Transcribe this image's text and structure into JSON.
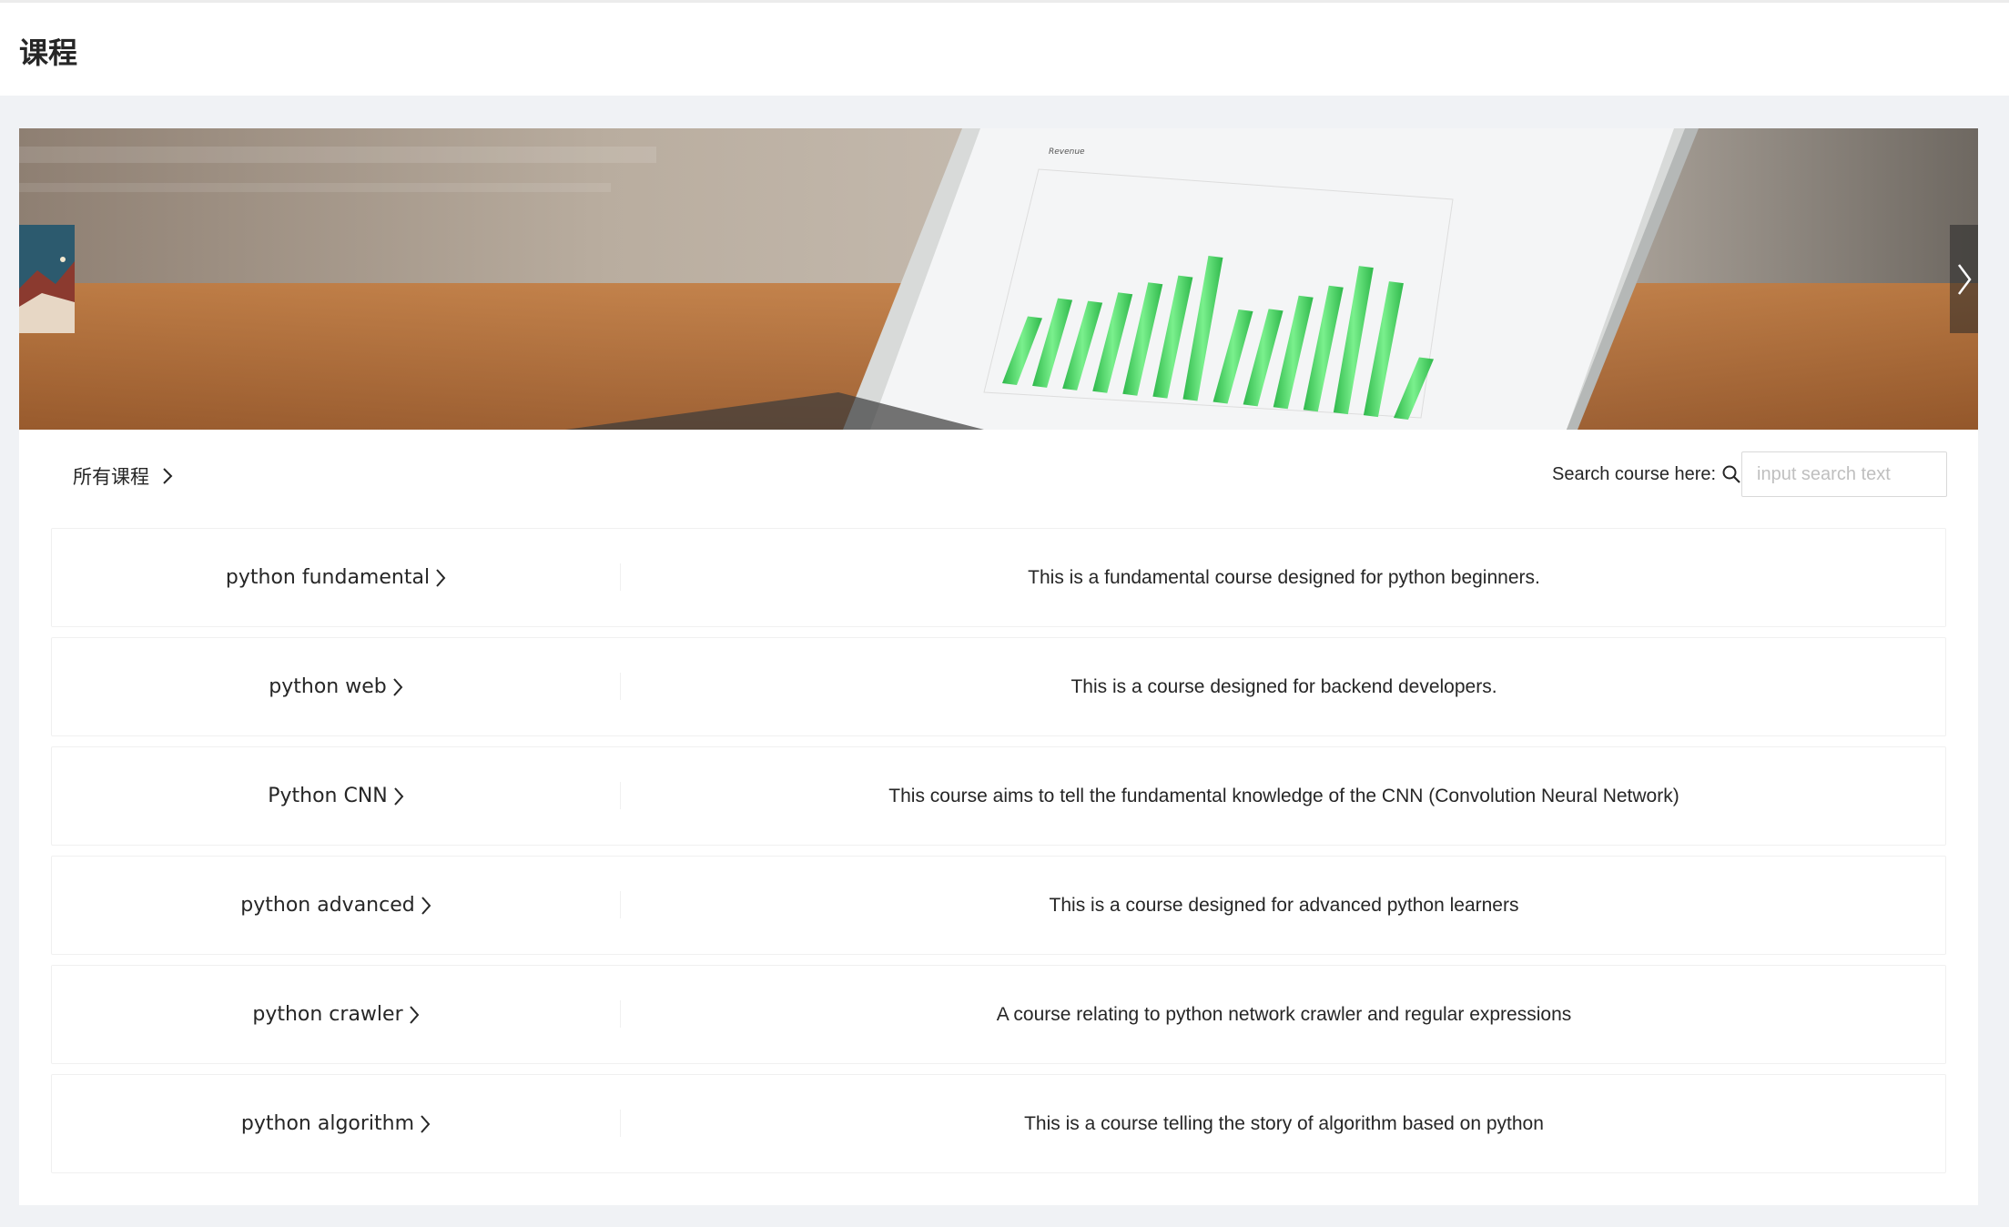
{
  "header": {
    "title": "课程"
  },
  "breadcrumb": {
    "label": "所有课程"
  },
  "search": {
    "label": "Search course here:",
    "placeholder": "input search text",
    "value": ""
  },
  "courses": [
    {
      "name": "python fundamental",
      "description": "This is a fundamental course designed for python beginners."
    },
    {
      "name": "python web",
      "description": "This is a course designed for backend developers."
    },
    {
      "name": "Python CNN",
      "description": "This course aims to tell the fundamental knowledge of the CNN (Convolution Neural Network)"
    },
    {
      "name": "python advanced",
      "description": "This is a course designed for advanced python learners"
    },
    {
      "name": "python crawler",
      "description": "A course relating to python network crawler and regular expressions"
    },
    {
      "name": "python algorithm",
      "description": "This is a course telling the story of algorithm based on python"
    }
  ],
  "banner": {
    "image_subject": "laptop showing a green bar chart",
    "chart_title": "Revenue"
  },
  "icons": {
    "breadcrumb": "chevron-right-icon",
    "search": "search-icon",
    "carousel_next": "chevron-right-icon",
    "course_link": "chevron-right-icon"
  },
  "colors": {
    "bar_green": "#4fd36a",
    "page_bg": "#f0f2f5",
    "card_bg": "#ffffff"
  }
}
